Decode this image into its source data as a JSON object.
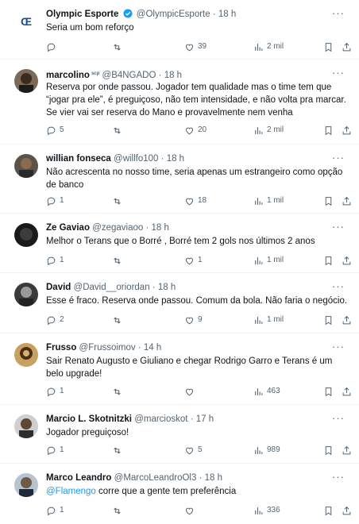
{
  "tweets": [
    {
      "name": "Olympic Esporte",
      "handle": "@OlympicEsporte",
      "time": "18 h",
      "verified": true,
      "text": "Seria um bom reforço",
      "replies": "",
      "retweets": "",
      "likes": "39",
      "views": "2 mil"
    },
    {
      "name": "marcolino",
      "name_badge": "scp",
      "handle": "@B4NGADO",
      "time": "18 h",
      "text": "Reserva por onde passou. Jogador tem qualidade mas o time tem que “jogar pra ele”, é preguiçoso, não tem intensidade, e não volta pra marcar. Se vier vai ser reserva do Mano e provavelmente nem venha",
      "replies": "5",
      "retweets": "",
      "likes": "20",
      "views": "2 mil"
    },
    {
      "name": "willian fonseca",
      "handle": "@willfo100",
      "time": "18 h",
      "text": "Não acrescenta no nosso time, seria apenas um estrangeiro como opção de banco",
      "replies": "1",
      "retweets": "",
      "likes": "18",
      "views": "1 mil"
    },
    {
      "name": "Ze Gaviao",
      "handle": "@zegaviaoo",
      "time": "18 h",
      "text": "Melhor o Terans que o Borré , Borré tem 2 gols nos últimos 2 anos",
      "replies": "1",
      "retweets": "",
      "likes": "1",
      "views": "1 mil"
    },
    {
      "name": "David",
      "handle": "@David__oriordan",
      "time": "18 h",
      "text": "Esse é fraco. Reserva onde passou. Comum da bola.  Não faria o negócio.",
      "replies": "2",
      "retweets": "",
      "likes": "9",
      "views": "1 mil"
    },
    {
      "name": "Frusso",
      "handle": "@Frussoimov",
      "time": "14 h",
      "text": "Sair Renato Augusto e Giuliano e chegar Rodrigo Garro e Terans é um belo upgrade!",
      "replies": "1",
      "retweets": "",
      "likes": "",
      "views": "463"
    },
    {
      "name": "Marcio L. Skotnitzki",
      "handle": "@marcioskot",
      "time": "17 h",
      "text": "Jogador preguiçoso!",
      "replies": "1",
      "retweets": "",
      "likes": "5",
      "views": "989"
    },
    {
      "name": "Marco Leandro",
      "handle": "@MarcoLeandroOl3",
      "time": "18 h",
      "mention": "@Flamengo",
      "text": " corre que a gente tem preferência",
      "replies": "1",
      "retweets": "",
      "likes": "",
      "views": "336"
    }
  ],
  "ui": {
    "separator": "·",
    "more": "···"
  },
  "icons": {
    "more": "ellipsis-icon",
    "reply": "reply-icon",
    "retweet": "retweet-icon",
    "like": "heart-icon",
    "views": "views-icon",
    "bookmark": "bookmark-icon",
    "share": "share-icon",
    "verified": "verified-badge-icon"
  },
  "colors": {
    "text": "#0f1419",
    "secondary": "#536471",
    "link": "#1d9bf0",
    "verified": "#1d9bf0",
    "divider": "#eff3f4"
  }
}
